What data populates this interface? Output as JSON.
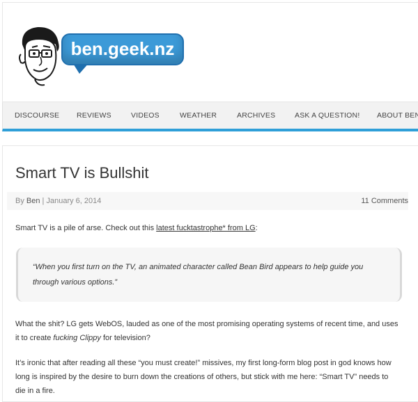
{
  "site": {
    "logo_text": "ben.geek.nz"
  },
  "nav": {
    "items": [
      "Discourse",
      "Reviews",
      "Videos",
      "Weather",
      "Archives",
      "Ask a Question!",
      "About Ben"
    ]
  },
  "post": {
    "title": "Smart TV is Bullshit",
    "meta": {
      "by": "By",
      "author": "Ben",
      "separator": "|",
      "date": "January 6, 2014",
      "comments": "11 Comments"
    },
    "intro": "Smart TV is a pile of arse. Check out this",
    "intro_link": "latest fucktastrophe* from LG",
    "intro_end": ":",
    "quote": "“When you first turn on the TV, an animated character called Bean Bird appears to help guide you through various options.”",
    "para2_start": "What the shit? LG gets WebOS, lauded as one of the most promising operating systems of recent time, and uses it to create",
    "para2_em": "fucking Clippy",
    "para2_end": "for television?",
    "para3": "It’s ironic that after reading all these “you must create!” missives, my first long-form blog post in god knows how long is inspired by the desire to burn down the creations of others, but stick with me here: “Smart TV” needs to die in a fire."
  },
  "colors": {
    "accent": "#2f9fd8",
    "logo_blue": "#3c9ad8"
  }
}
